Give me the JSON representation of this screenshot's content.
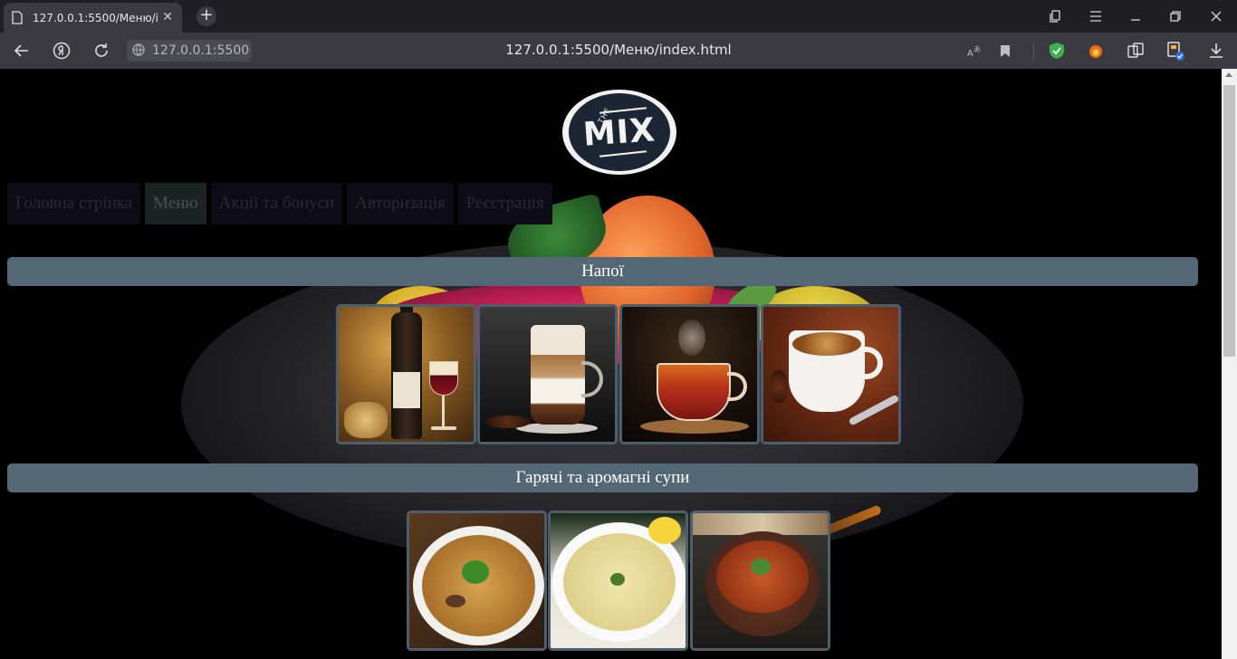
{
  "browser": {
    "tab_title": "127.0.0.1:5500/Меню/index.html",
    "tab_close": "✕",
    "new_tab": "+",
    "site_chip": "127.0.0.1:5500",
    "url": "127.0.0.1:5500/Меню/index.html"
  },
  "site": {
    "logo_the": "THE",
    "logo_text": "MIX"
  },
  "menu": {
    "items": [
      {
        "label": "Головна стрінка",
        "active": false
      },
      {
        "label": "Меню",
        "active": true
      },
      {
        "label": "Акції та бонуси",
        "active": false
      },
      {
        "label": "Авторизація",
        "active": false
      },
      {
        "label": "Реєстрація",
        "active": false
      }
    ]
  },
  "sections": [
    {
      "title": "Напої",
      "images": [
        "wine",
        "latte",
        "tea",
        "coffee"
      ]
    },
    {
      "title": "Гарячі та аромагні супи",
      "images": [
        "mushroom-noodle-soup",
        "cream-soup",
        "tomato-meat-soup"
      ]
    }
  ],
  "colors": {
    "section_bar": "#536874",
    "card_border": "#4d5f6a",
    "menu_bg": "#0d0b16",
    "menu_active_bg": "#1b2422",
    "page_bg": "#000000"
  }
}
